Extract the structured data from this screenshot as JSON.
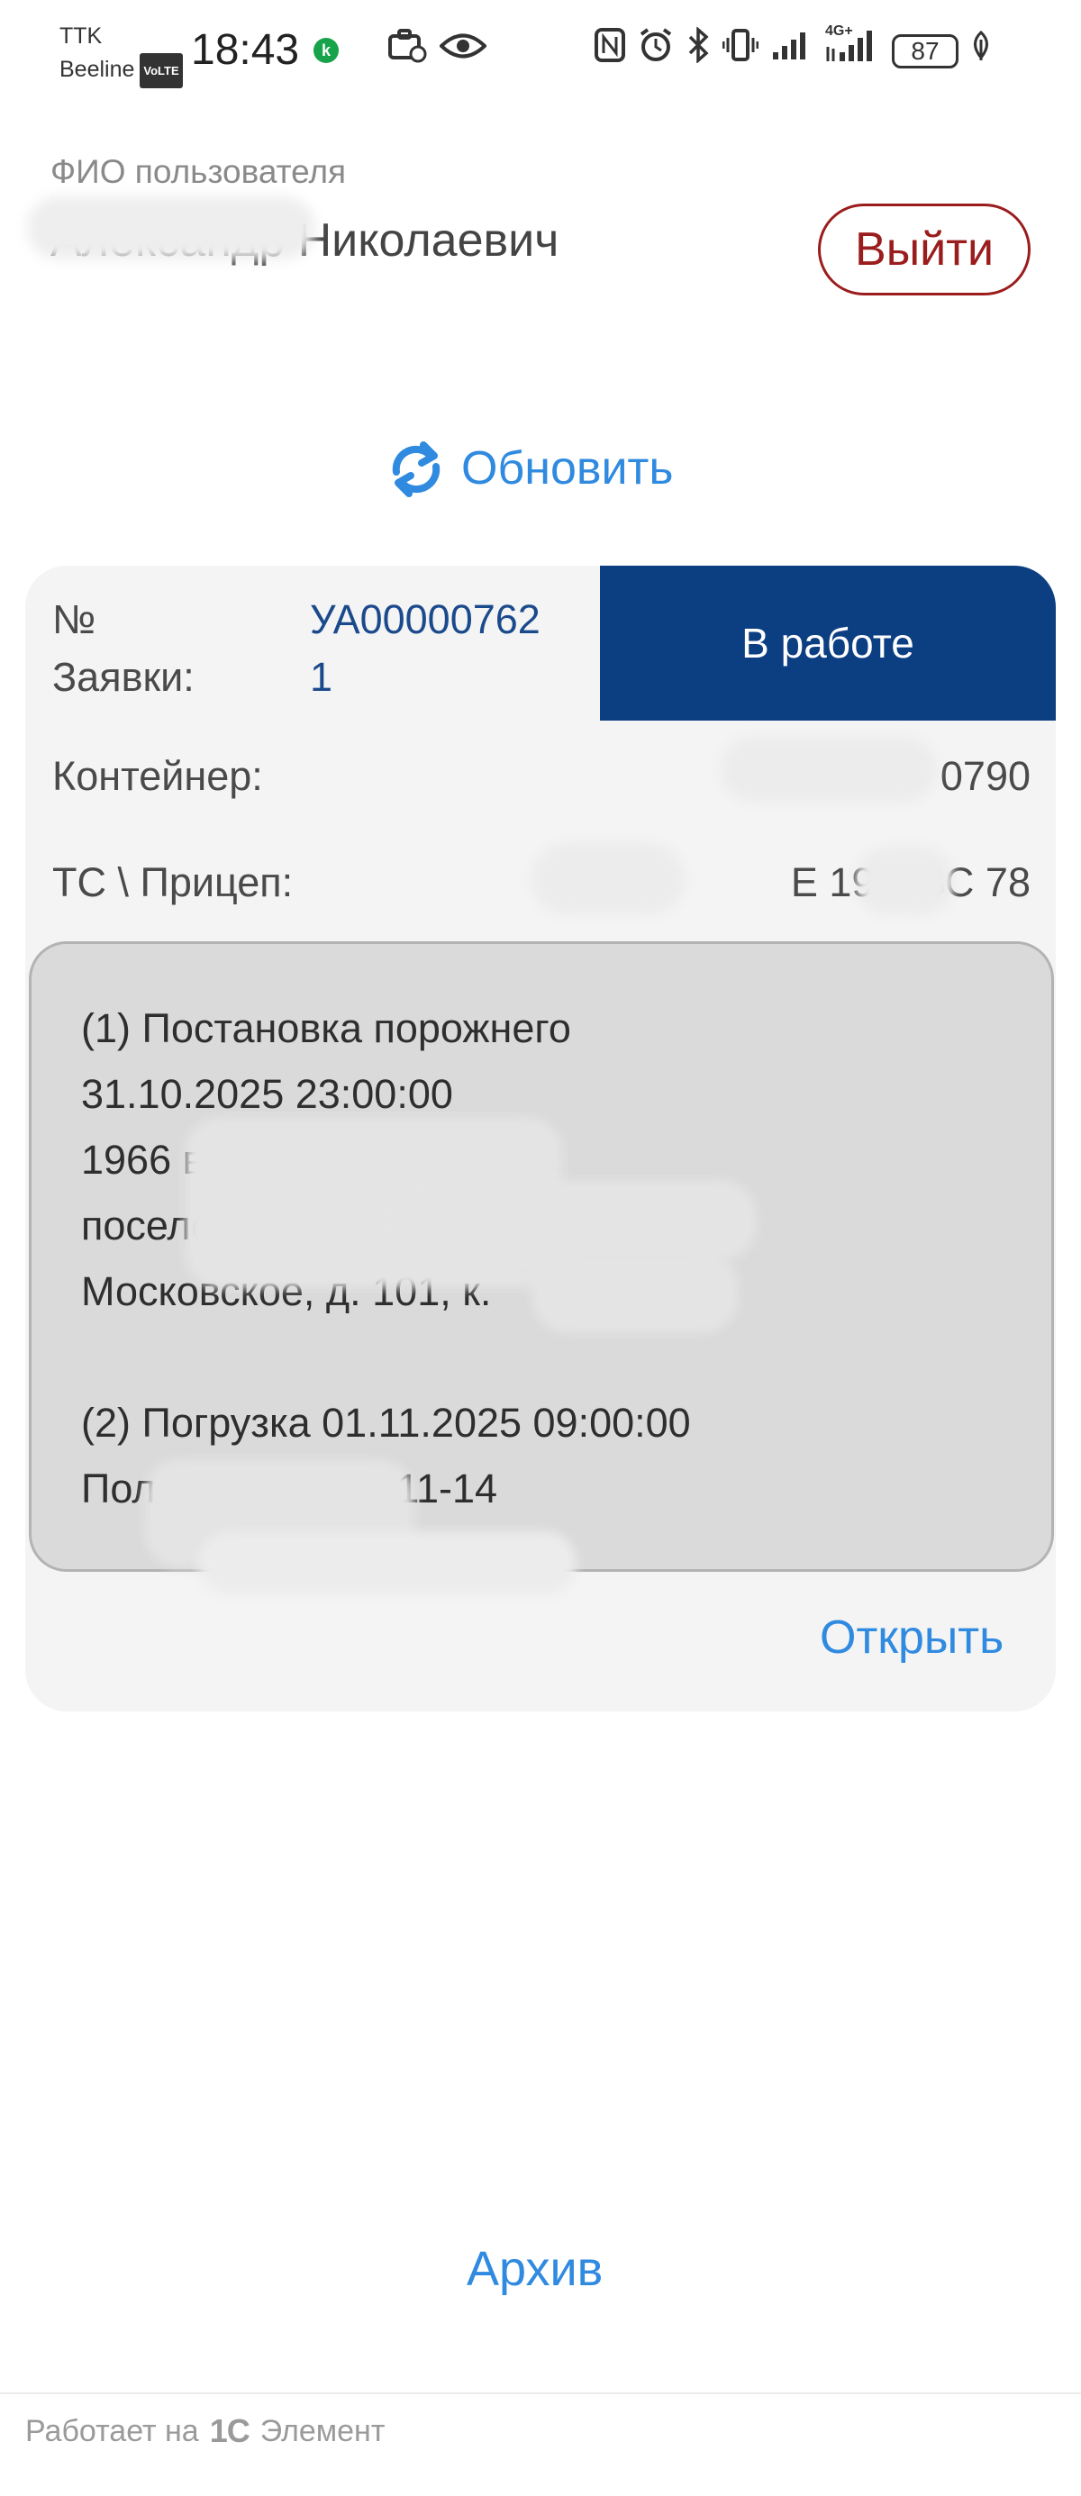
{
  "status_bar": {
    "carrier_1": "TTK",
    "carrier_2": "Beeline",
    "volte": "VoLTE",
    "time": "18:43",
    "kicon_letter": "k",
    "network": "4G+",
    "battery": "87"
  },
  "header": {
    "user_label": "ФИО пользователя",
    "user_name": "Александр Николаевич",
    "logout_label": "Выйти"
  },
  "refresh": {
    "label": "Обновить"
  },
  "card": {
    "order_label_1": "№",
    "order_label_2": "Заявки:",
    "order_number_1": "УА00000762",
    "order_number_2": "1",
    "status": "В работе",
    "container_label": "Контейнер:",
    "container_value": "0790",
    "vehicle_label": "ТС \\ Прицеп:",
    "vehicle_value": "Е 198\\ ВС 78",
    "route_text": "(1) Постановка порожнего\n31.10.2025 23:00:00\n1966 вн.тер.г.\nпоселок\nМосковское, д. 101, к.\n\n(2) Погрузка 01.11.2025 09:00:00\nПол , 85, ворота 11-14",
    "open_label": "Открыть"
  },
  "archive_label": "Архив",
  "footer": {
    "powered": "Работает на",
    "logo": "1С",
    "product": "Элемент"
  },
  "colors": {
    "accent": "#2f8ae0",
    "status_bg": "#0c3e82",
    "logout": "#9b1c1c",
    "card_bg": "#f4f4f4",
    "route_bg": "#dadada"
  }
}
